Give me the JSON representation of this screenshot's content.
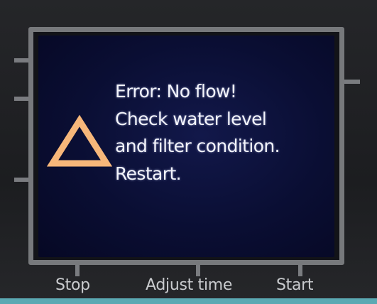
{
  "display": {
    "icon": "warning-triangle-icon",
    "icon_color": "#f7b77a",
    "message_lines": [
      "Error: No flow!",
      "Check water level",
      "and filter condition.",
      "Restart."
    ]
  },
  "buttons": {
    "stop": "Stop",
    "adjust_time": "Adjust time",
    "start": "Start"
  },
  "colors": {
    "screen_background": "#0a0e33",
    "text": "#f3f4fb",
    "bezel": "#77797c",
    "accent_strip": "#5ba9b3"
  }
}
